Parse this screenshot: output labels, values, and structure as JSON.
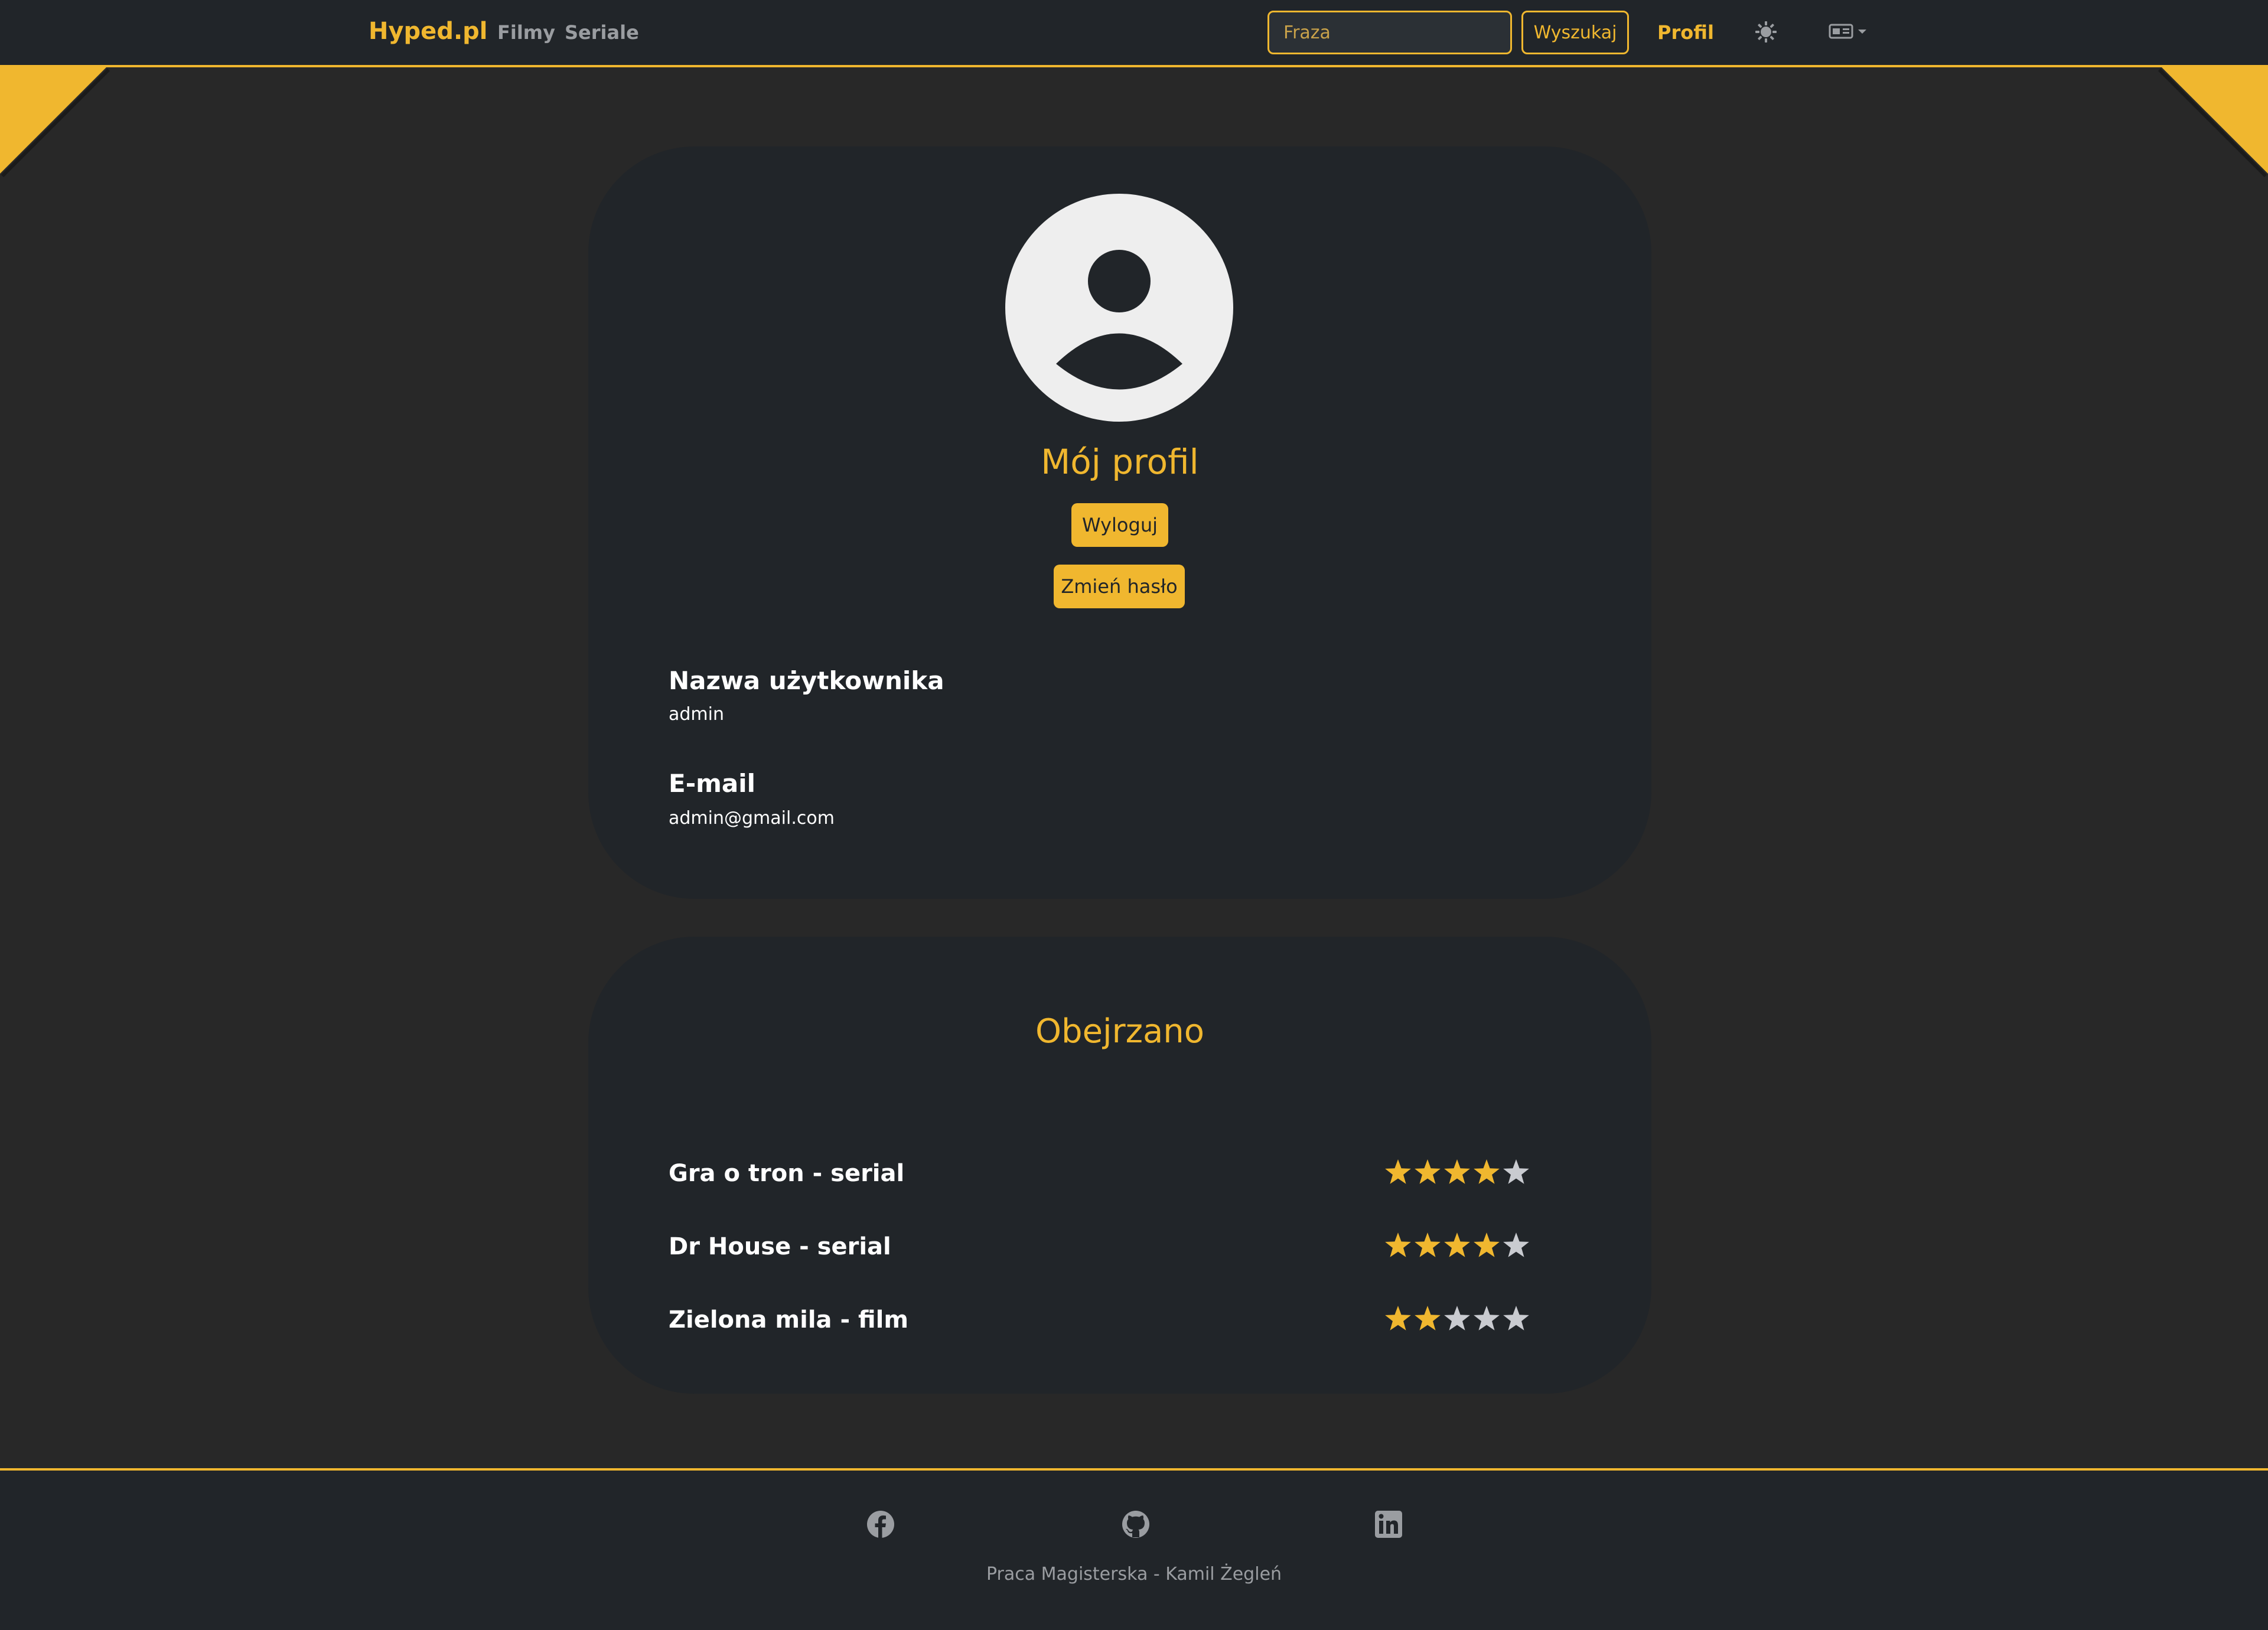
{
  "navbar": {
    "brand": "Hyped.pl",
    "links": [
      "Filmy",
      "Seriale"
    ],
    "search_placeholder": "Fraza",
    "search_button": "Wyszukaj",
    "profile_link": "Profil"
  },
  "profile": {
    "title": "Mój profil",
    "logout_button": "Wyloguj",
    "change_password_button": "Zmień hasło",
    "fields": [
      {
        "label": "Nazwa użytkownika",
        "value": "admin"
      },
      {
        "label": "E-mail",
        "value": "admin@gmail.com"
      }
    ]
  },
  "watched": {
    "title": "Obejrzano",
    "items": [
      {
        "name": "Gra o tron - serial",
        "rating": 4,
        "max": 5
      },
      {
        "name": "Dr House - serial",
        "rating": 4,
        "max": 5
      },
      {
        "name": "Zielona mila - film",
        "rating": 2,
        "max": 5
      }
    ]
  },
  "footer": {
    "text": "Praca Magisterska - Kamil Żegleń",
    "social_icons": [
      "facebook-icon",
      "github-icon",
      "linkedin-icon"
    ]
  },
  "colors": {
    "accent": "#f0b72f",
    "background": "#282828",
    "card": "#212529",
    "star_empty": "#c9cbd0"
  }
}
